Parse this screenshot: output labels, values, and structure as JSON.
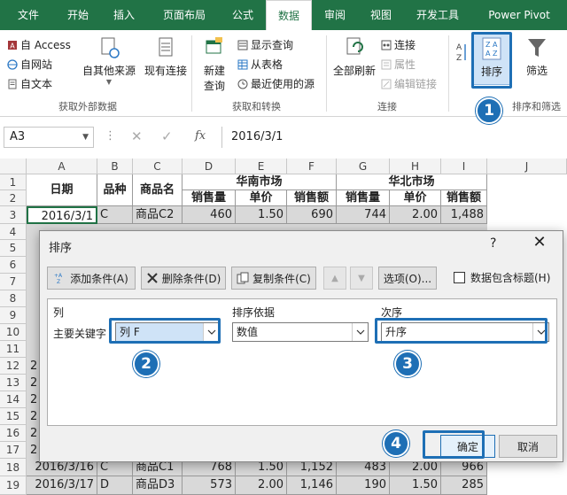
{
  "ribbon_tabs": [
    "文件",
    "开始",
    "插入",
    "页面布局",
    "公式",
    "数据",
    "审阅",
    "视图",
    "开发工具",
    "Power Pivot"
  ],
  "active_tab": "数据",
  "colors": {
    "excel_green": "#217346",
    "highlight_blue": "#1e6fb5",
    "selected_blue": "#cfe3f7"
  },
  "ribbon": {
    "external_data": {
      "from_access": "自 Access",
      "from_web": "自网站",
      "from_text": "自文本",
      "from_other": "自其他来源",
      "existing_conn": "现有连接",
      "label": "获取外部数据"
    },
    "transform": {
      "new_query_1": "新建",
      "new_query_2": "查询",
      "show_queries": "显示查询",
      "from_table": "从表格",
      "recent_sources": "最近使用的源",
      "label": "获取和转换"
    },
    "connections": {
      "refresh_all": "全部刷新",
      "connections": "连接",
      "properties": "属性",
      "edit_links": "编辑链接",
      "label": "连接"
    },
    "sort_filter": {
      "sort": "排序",
      "filter": "筛选",
      "label": "排序和筛选"
    }
  },
  "formula_bar": {
    "name_box": "A3",
    "fx": "fx",
    "formula": "2016/3/1"
  },
  "grid": {
    "columns": [
      "A",
      "B",
      "C",
      "D",
      "E",
      "F",
      "G",
      "H",
      "I",
      "J"
    ],
    "rows": [
      "1",
      "2",
      "3",
      "4",
      "5",
      "6",
      "7",
      "8",
      "9",
      "10",
      "11",
      "12",
      "13",
      "14",
      "15",
      "16",
      "17",
      "18",
      "19"
    ],
    "header": {
      "date": "日期",
      "variety": "品种",
      "product": "商品名",
      "south": "华南市场",
      "north": "华北市场",
      "sales_qty": "销售量",
      "unit_price": "单价",
      "sales_amt": "销售额"
    },
    "data_rows": [
      {
        "row": "3",
        "cells": [
          "2016/3/1",
          "C",
          "商品C2",
          "460",
          "1.50",
          "690",
          "744",
          "2.00",
          "1,488"
        ]
      },
      {
        "row": "18",
        "cells": [
          "2016/3/16",
          "C",
          "商品C1",
          "768",
          "1.50",
          "1,152",
          "483",
          "2.00",
          "966"
        ]
      },
      {
        "row": "19",
        "cells": [
          "2016/3/17",
          "D",
          "商品D3",
          "573",
          "2.00",
          "1,146",
          "190",
          "1.50",
          "285"
        ]
      }
    ],
    "partial_col_a": "2"
  },
  "dialog": {
    "title": "排序",
    "help": "?",
    "close": "✕",
    "add_level": "添加条件(A)",
    "delete_level": "删除条件(D)",
    "copy_level": "复制条件(C)",
    "up": "▲",
    "down": "▼",
    "options": "选项(O)...",
    "has_headers": "数据包含标题(H)",
    "col_header": "列",
    "sort_on_header": "排序依据",
    "order_header": "次序",
    "row_label": "主要关键字",
    "column_value": "列 F",
    "sort_on_value": "数值",
    "order_value": "升序",
    "ok": "确定",
    "cancel": "取消"
  },
  "badges": [
    "1",
    "2",
    "3",
    "4"
  ]
}
